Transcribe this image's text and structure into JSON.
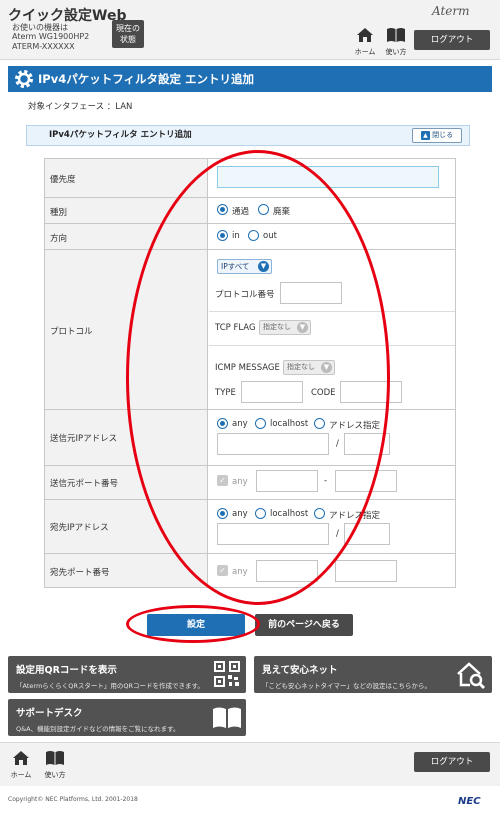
{
  "header": {
    "app_title": "クイック設定Web",
    "device_lines": [
      "お使いの機器は",
      "Aterm WG1900HP2",
      "ATERM-XXXXXX"
    ],
    "status_button": [
      "現在の",
      "状態"
    ],
    "brand": "Aterm",
    "home_label": "ホーム",
    "manual_label": "使い方",
    "logout_label": "ログアウト"
  },
  "page": {
    "title": "IPv4パケットフィルタ設定 エントリ追加",
    "interface_line": "対象インタフェース ：LAN",
    "section_title": "IPv4パケットフィルタ エントリ追加",
    "close_label": "閉じる"
  },
  "form": {
    "priority": {
      "label": "優先度",
      "value": ""
    },
    "type": {
      "label": "種別",
      "options": [
        "通過",
        "廃棄"
      ],
      "selected": "通過"
    },
    "direction": {
      "label": "方向",
      "options": [
        "in",
        "out"
      ],
      "selected": "in"
    },
    "protocol": {
      "label": "プロトコル",
      "select_value": "IPすべて",
      "protocol_number_label": "プロトコル番号",
      "tcp_flag_label": "TCP FLAG",
      "tcp_flag_value": "指定なし",
      "icmp_label": "ICMP MESSAGE",
      "icmp_value": "指定なし",
      "type_label": "TYPE",
      "code_label": "CODE"
    },
    "src_ip": {
      "label": "送信元IPアドレス",
      "options": [
        "any",
        "localhost",
        "アドレス指定"
      ],
      "selected": "any",
      "slash": "/"
    },
    "src_port": {
      "label": "送信元ポート番号",
      "any_label": "any",
      "dash": "-"
    },
    "dst_ip": {
      "label": "宛先IPアドレス",
      "options": [
        "any",
        "localhost",
        "アドレス指定"
      ],
      "selected": "any",
      "slash": "/"
    },
    "dst_port": {
      "label": "宛先ポート番号",
      "any_label": "any",
      "dash": "-"
    }
  },
  "actions": {
    "set_label": "設定",
    "back_label": "前のページへ戻る"
  },
  "tiles": [
    {
      "title": "設定用QRコードを表示",
      "desc": "「AtermらくらくQRスタート」用のQRコードを作成できます。",
      "icon": "qr-code-icon"
    },
    {
      "title": "見えて安心ネット",
      "desc": "「こども安心ネットタイマー」などの設定はこちらから。",
      "icon": "house-search-icon"
    },
    {
      "title": "サポートデスク",
      "desc": "Q&A、機能別設定ガイドなどの情報をご覧になれます。",
      "icon": "book-icon"
    }
  ],
  "footer": {
    "home_label": "ホーム",
    "manual_label": "使い方",
    "logout_label": "ログアウト",
    "copyright": "Copyright© NEC Platforms, Ltd. 2001-2018",
    "nec": "NEC"
  },
  "colors": {
    "accent": "#1f6fb4",
    "dark_button": "#4a4a4a",
    "annotation": "#e60012"
  }
}
